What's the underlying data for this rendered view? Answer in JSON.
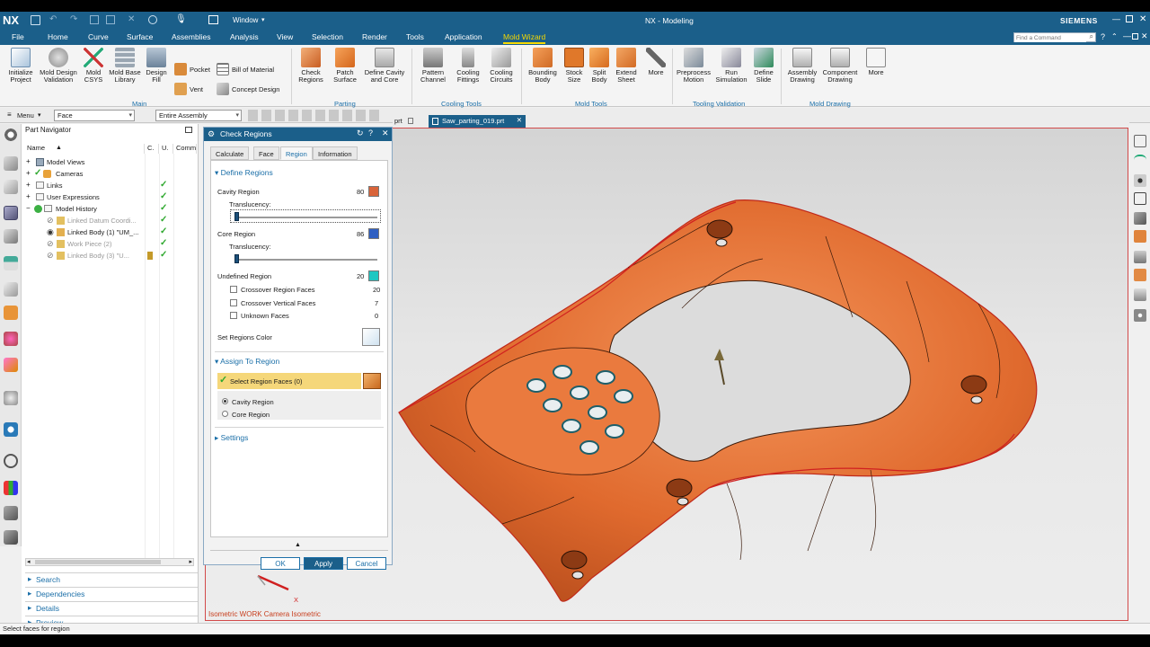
{
  "app": {
    "logo": "NX",
    "window_menu": "Window",
    "title": "NX - Modeling",
    "brand": "SIEMENS",
    "command_search_placeholder": "Find a Command"
  },
  "menus": [
    "File",
    "Home",
    "Curve",
    "Surface",
    "Assemblies",
    "Analysis",
    "View",
    "Selection",
    "Render",
    "Tools",
    "Application",
    "Mold Wizard"
  ],
  "active_menu": "Mold Wizard",
  "ribbon": {
    "main": {
      "initialize_project": "Initialize\nProject",
      "mold_design_validation": "Mold Design\nValidation",
      "mold_csys": "Mold\nCSYS",
      "mold_base_library": "Mold Base\nLibrary",
      "design_fill": "Design\nFill",
      "pocket": "Pocket",
      "vent": "Vent",
      "bill_of_material": "Bill of Material",
      "concept_design": "Concept Design",
      "group": "Main"
    },
    "parting": {
      "check_regions": "Check\nRegions",
      "patch_surface": "Patch\nSurface",
      "define_cavity_core": "Define Cavity\nand Core",
      "group": "Parting"
    },
    "cooling": {
      "pattern_channel": "Pattern\nChannel",
      "cooling_fittings": "Cooling\nFittings",
      "cooling_circuits": "Cooling\nCircuits",
      "group": "Cooling Tools"
    },
    "mold_tools": {
      "bounding_body": "Bounding\nBody",
      "stock_size": "Stock\nSize",
      "split_body": "Split\nBody",
      "extend_sheet": "Extend\nSheet",
      "more": "More",
      "group": "Mold Tools"
    },
    "tooling": {
      "preprocess_motion": "Preprocess\nMotion",
      "run_simulation": "Run\nSimulation",
      "define_slide": "Define\nSlide",
      "group": "Tooling Validation"
    },
    "drawing": {
      "assembly_drawing": "Assembly\nDrawing",
      "component_drawing": "Component\nDrawing",
      "more": "More",
      "group": "Mold Drawing"
    }
  },
  "toolbar": {
    "menu": "Menu",
    "filter": "Face",
    "scope": "Entire Assembly"
  },
  "part_navigator": {
    "title": "Part Navigator",
    "columns": [
      "Name",
      "C.",
      "U.",
      "Comm"
    ],
    "rows": [
      {
        "label": "Model Views",
        "check": ""
      },
      {
        "label": "Cameras",
        "check": ""
      },
      {
        "label": "Links",
        "check": "✓"
      },
      {
        "label": "User Expressions",
        "check": "✓"
      },
      {
        "label": "Model History",
        "check": "✓"
      },
      {
        "label": "Linked Datum Coordi...",
        "check": "✓"
      },
      {
        "label": "Linked Body (1) \"UM_...",
        "check": "✓"
      },
      {
        "label": "Work Piece (2)",
        "check": "✓"
      },
      {
        "label": "Linked Body (3) \"U...",
        "check": "✓"
      }
    ],
    "panels": [
      "Search",
      "Dependencies",
      "Details",
      "Preview"
    ]
  },
  "dialog": {
    "title": "Check Regions",
    "tabs": [
      "Calculate",
      "Face",
      "Region",
      "Information"
    ],
    "active_tab": "Region",
    "define_regions": "Define Regions",
    "cavity_region": {
      "label": "Cavity Region",
      "count": "80",
      "color": "#d9643a"
    },
    "translucency_label": "Translucency:",
    "core_region": {
      "label": "Core Region",
      "count": "86",
      "color": "#2f5fc2"
    },
    "undefined_region": {
      "label": "Undefined Region",
      "count": "20",
      "color": "#1ec7c2"
    },
    "crossover_region_faces": {
      "label": "Crossover Region Faces",
      "count": "20"
    },
    "crossover_vertical_faces": {
      "label": "Crossover Vertical Faces",
      "count": "7"
    },
    "unknown_faces": {
      "label": "Unknown Faces",
      "count": "0"
    },
    "set_regions_color": "Set Regions Color",
    "assign_to_region": "Assign To Region",
    "select_region_faces": "Select Region Faces (0)",
    "radio_cavity": "Cavity Region",
    "radio_core": "Core Region",
    "settings": "Settings",
    "ok": "OK",
    "apply": "Apply",
    "cancel": "Cancel"
  },
  "tabs_doc": {
    "prev_tab": "prt",
    "active_tab": "Saw_parting_019.prt"
  },
  "viewport": {
    "view_label": "Isometric WORK Camera Isometric",
    "axis_x": "X",
    "part_color": "#e8783c"
  },
  "status": "Select faces for region"
}
